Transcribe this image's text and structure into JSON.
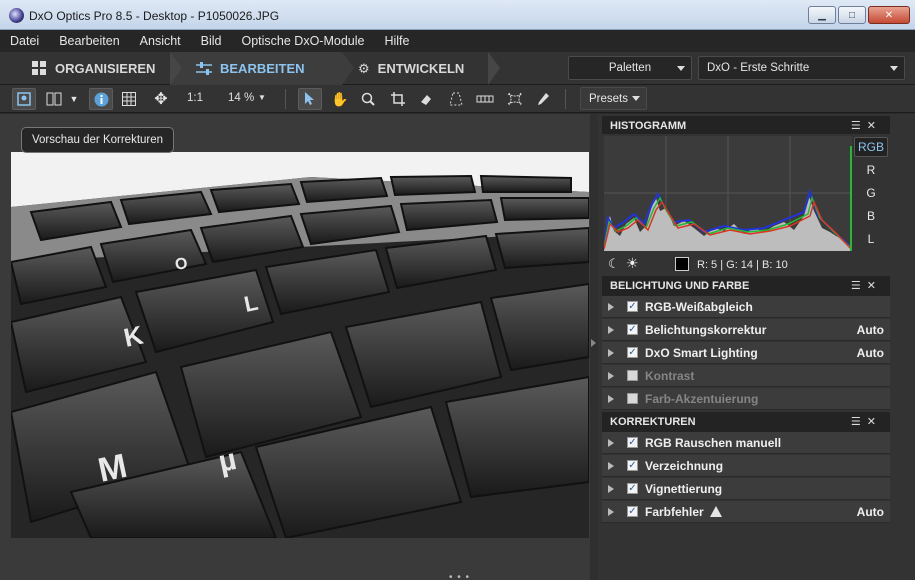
{
  "window": {
    "title": "DxO Optics Pro 8.5 - Desktop - P1050026.JPG",
    "buttons": {
      "minimize": "▁",
      "maximize": "□",
      "close": "✕"
    }
  },
  "menu": [
    "Datei",
    "Bearbeiten",
    "Ansicht",
    "Bild",
    "Optische DxO-Module",
    "Hilfe"
  ],
  "modes": {
    "organize": "ORGANISIEREN",
    "edit": "BEARBEITEN",
    "develop": "ENTWICKELN",
    "active": "edit"
  },
  "palettes_dropdown": "Paletten",
  "workspace_dropdown": "DxO - Erste Schritte",
  "toolbar": {
    "ratio": "1:1",
    "zoom": "14 %",
    "presets": "Presets"
  },
  "tooltip": "Vorschau der Korrekturen",
  "histogram": {
    "title": "HISTOGRAMM",
    "channels": [
      "RGB",
      "R",
      "G",
      "B",
      "L"
    ],
    "selected_channel": "RGB",
    "readout": "R:   5 | G:  14 | B:  10"
  },
  "exposure_panel": {
    "title": "BELICHTUNG UND FARBE",
    "rows": [
      {
        "label": "RGB-Weißabgleich",
        "checked": true,
        "value": ""
      },
      {
        "label": "Belichtungskorrektur",
        "checked": true,
        "value": "Auto"
      },
      {
        "label": "DxO Smart Lighting",
        "checked": true,
        "value": "Auto"
      },
      {
        "label": "Kontrast",
        "checked": false,
        "value": ""
      },
      {
        "label": "Farb-Akzentuierung",
        "checked": false,
        "value": ""
      }
    ]
  },
  "corrections_panel": {
    "title": "KORREKTUREN",
    "rows": [
      {
        "label": "RGB Rauschen manuell",
        "checked": true,
        "value": ""
      },
      {
        "label": "Verzeichnung",
        "checked": true,
        "value": ""
      },
      {
        "label": "Vignettierung",
        "checked": true,
        "value": ""
      },
      {
        "label": "Farbfehler",
        "checked": true,
        "value": "Auto"
      }
    ]
  },
  "photo_key_labels": [
    "K",
    "L",
    "M",
    "µ",
    "O"
  ]
}
